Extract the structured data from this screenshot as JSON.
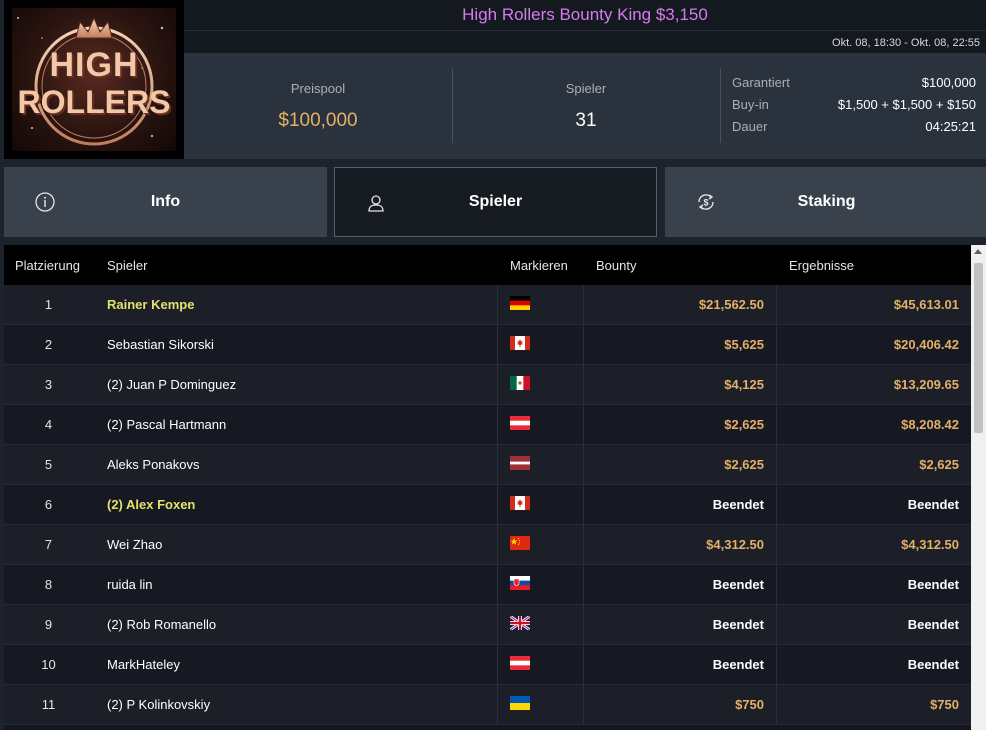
{
  "header": {
    "logo_text_line1": "HIGH",
    "logo_text_line2": "ROLLERS",
    "title": "High Rollers Bounty King $3,150",
    "dates": "Okt. 08, 18:30 - Okt. 08, 22:55"
  },
  "stats": {
    "prizepool_label": "Preispool",
    "prizepool_value": "$100,000",
    "players_label": "Spieler",
    "players_value": "31",
    "details": [
      {
        "key": "Garantiert",
        "value": "$100,000"
      },
      {
        "key": "Buy-in",
        "value": "$1,500 + $1,500 + $150"
      },
      {
        "key": "Dauer",
        "value": "04:25:21"
      }
    ]
  },
  "tabs": [
    {
      "label": "Info",
      "icon": "info-icon"
    },
    {
      "label": "Spieler",
      "icon": "user-icon"
    },
    {
      "label": "Staking",
      "icon": "dollar-cycle-icon"
    }
  ],
  "table": {
    "columns": [
      "Platzierung",
      "Spieler",
      "Markieren",
      "Bounty",
      "Ergebnisse"
    ],
    "rows": [
      {
        "rank": "1",
        "name": "Rainer Kempe",
        "flag": "de",
        "bounty": "$21,562.50",
        "result": "$45,613.01",
        "highlight": true
      },
      {
        "rank": "2",
        "name": "Sebastian Sikorski",
        "flag": "ca",
        "bounty": "$5,625",
        "result": "$20,406.42",
        "highlight": false
      },
      {
        "rank": "3",
        "name": "(2) Juan P Dominguez",
        "flag": "mx",
        "bounty": "$4,125",
        "result": "$13,209.65",
        "highlight": false
      },
      {
        "rank": "4",
        "name": "(2) Pascal Hartmann",
        "flag": "at",
        "bounty": "$2,625",
        "result": "$8,208.42",
        "highlight": false
      },
      {
        "rank": "5",
        "name": "Aleks Ponakovs",
        "flag": "lv",
        "bounty": "$2,625",
        "result": "$2,625",
        "highlight": false
      },
      {
        "rank": "6",
        "name": "(2) Alex Foxen",
        "flag": "ca",
        "bounty": "Beendet",
        "result": "Beendet",
        "highlight": true
      },
      {
        "rank": "7",
        "name": "Wei Zhao",
        "flag": "cn",
        "bounty": "$4,312.50",
        "result": "$4,312.50",
        "highlight": false
      },
      {
        "rank": "8",
        "name": "ruida lin",
        "flag": "sk",
        "bounty": "Beendet",
        "result": "Beendet",
        "highlight": false
      },
      {
        "rank": "9",
        "name": "(2) Rob Romanello",
        "flag": "gb",
        "bounty": "Beendet",
        "result": "Beendet",
        "highlight": false
      },
      {
        "rank": "10",
        "name": "MarkHateley",
        "flag": "at",
        "bounty": "Beendet",
        "result": "Beendet",
        "highlight": false
      },
      {
        "rank": "11",
        "name": "(2) P Kolinkovskiy",
        "flag": "ua",
        "bounty": "$750",
        "result": "$750",
        "highlight": false
      }
    ]
  },
  "colors": {
    "gold": "#e3b065",
    "highlight_name": "#e5e26c",
    "title": "#d67af0"
  }
}
